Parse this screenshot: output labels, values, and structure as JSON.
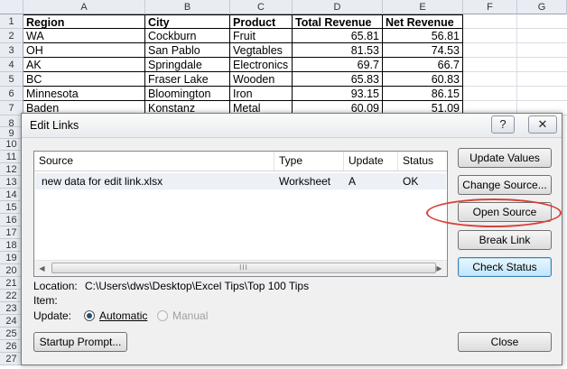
{
  "spreadsheet": {
    "columns": [
      "A",
      "B",
      "C",
      "D",
      "E",
      "F",
      "G"
    ],
    "rows": [
      "1",
      "2",
      "3",
      "4",
      "5",
      "6",
      "7",
      "8",
      "9",
      "10",
      "11",
      "12",
      "13",
      "14",
      "15",
      "16",
      "17",
      "18",
      "19",
      "20",
      "21",
      "22",
      "23",
      "24",
      "25",
      "26",
      "27"
    ],
    "header": [
      "Region",
      "City",
      "Product",
      "Total Revenue",
      "Net Revenue"
    ],
    "data": [
      [
        "WA",
        "Cockburn",
        "Fruit",
        "65.81",
        "56.81"
      ],
      [
        "OH",
        "San Pablo",
        "Vegtables",
        "81.53",
        "74.53"
      ],
      [
        "AK",
        "Springdale",
        "Electronics",
        "69.7",
        "66.7"
      ],
      [
        "BC",
        "Fraser Lake",
        "Wooden",
        "65.83",
        "60.83"
      ],
      [
        "Minnesota",
        "Bloomington",
        "Iron",
        "93.15",
        "86.15"
      ],
      [
        "Baden",
        "Konstanz",
        "Metal",
        "60.09",
        "51.09"
      ]
    ]
  },
  "dialog": {
    "title": "Edit Links",
    "help_glyph": "?",
    "close_glyph": "✕",
    "list": {
      "columns": [
        "Source",
        "Type",
        "Update",
        "Status"
      ],
      "row": {
        "source": "new data for edit link.xlsx",
        "type": "Worksheet",
        "update": "A",
        "status": "OK"
      },
      "scroll_left": "◀",
      "scroll_right": "▶",
      "thumb_grip": "III"
    },
    "buttons": {
      "update_values": "Update Values",
      "change_source": "Change Source...",
      "open_source": "Open Source",
      "break_link": "Break Link",
      "check_status": "Check Status",
      "startup_prompt": "Startup Prompt...",
      "close": "Close"
    },
    "location_label": "Location:",
    "location_value": "C:\\Users\\dws\\Desktop\\Excel Tips\\Top 100 Tips",
    "item_label": "Item:",
    "update_label": "Update:",
    "update_options": {
      "automatic": "Automatic",
      "manual": "Manual"
    },
    "highlight_color": "#d9403a"
  }
}
